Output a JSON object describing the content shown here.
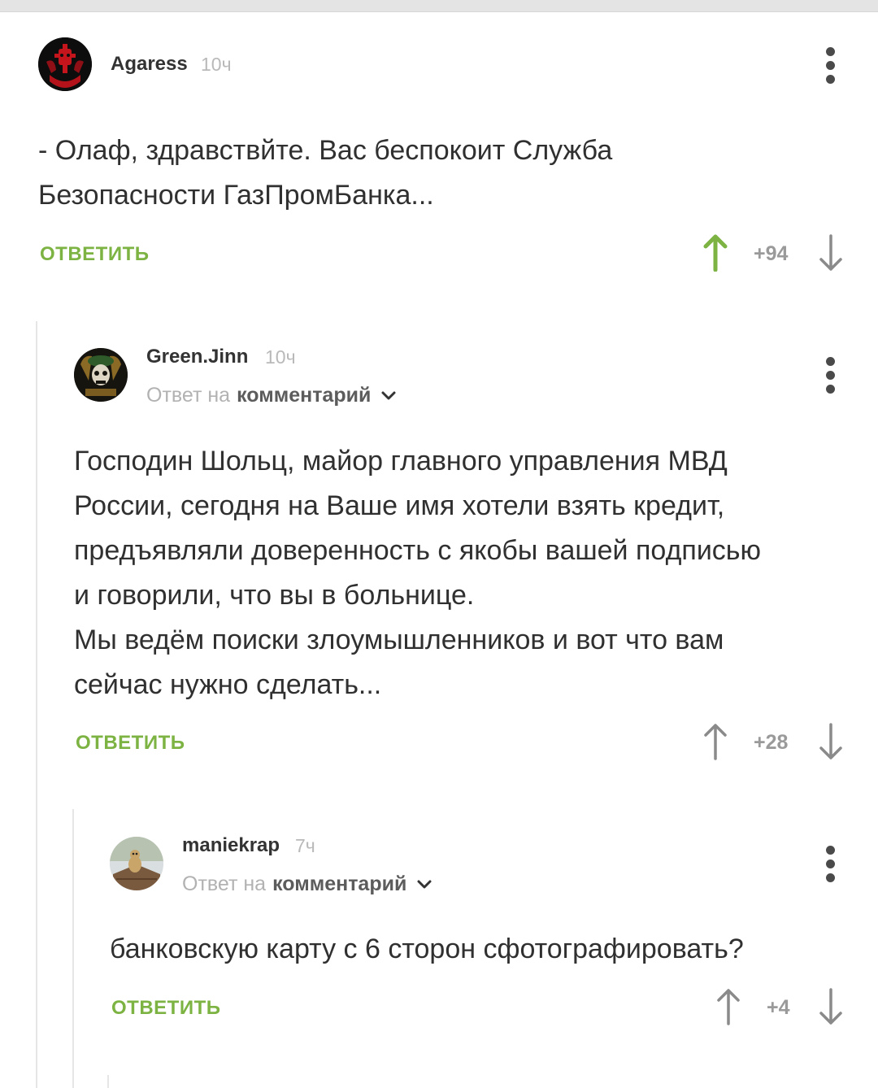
{
  "comments": [
    {
      "author": "Agaress",
      "time": "10ч",
      "text_lines": [
        "- Олаф, здравствйте. Вас беспокоит Служба",
        "Безопасности ГазПромБанка..."
      ],
      "reply_label": "ОТВЕТИТЬ",
      "score": "+94"
    },
    {
      "author": "Green.Jinn",
      "time": "10ч",
      "reply_to_prefix": "Ответ на",
      "reply_to_link": "комментарий",
      "text_lines": [
        "Господин Шольц, майор главного управления МВД",
        "России, сегодня на Ваше имя хотели взять кредит,",
        "предъявляли доверенность с якобы вашей подписью",
        "и говорили, что вы в больнице.",
        "Мы ведём поиски злоумышленников и вот что вам",
        "сейчас нужно сделать..."
      ],
      "reply_label": "ОТВЕТИТЬ",
      "score": "+28"
    },
    {
      "author": "maniekrap",
      "time": "7ч",
      "reply_to_prefix": "Ответ на",
      "reply_to_link": "комментарий",
      "text_lines": [
        "банковскую карту с 6 сторон сфотографировать?"
      ],
      "reply_label": "ОТВЕТИТЬ",
      "score": "+4"
    }
  ],
  "colors": {
    "accent_green": "#7cb342",
    "upvote_active": "#7cb342",
    "vote_inactive": "#8a8a8a"
  },
  "icons": [
    "kebab-menu-icon",
    "upvote-arrow-icon",
    "downvote-arrow-icon",
    "chevron-down-icon"
  ]
}
